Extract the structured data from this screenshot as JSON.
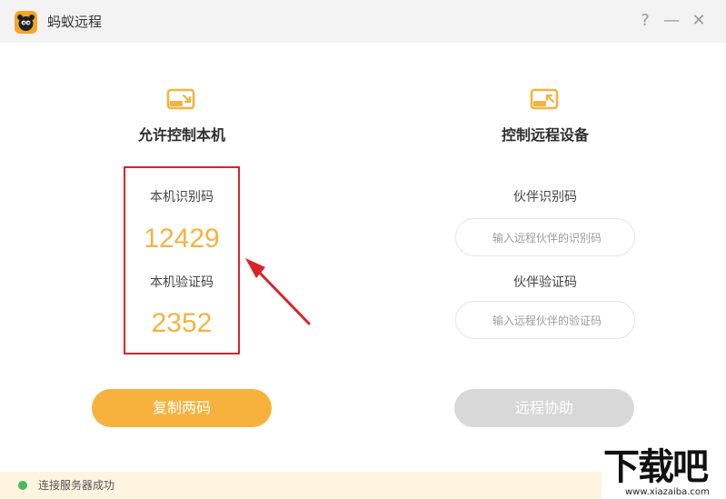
{
  "window": {
    "title": "蚂蚁远程",
    "help": "?",
    "minimize": "—",
    "close": "✕"
  },
  "left_panel": {
    "heading": "允许控制本机",
    "id_label": "本机识别码",
    "id_value": "12429",
    "code_label": "本机验证码",
    "code_value": "2352",
    "copy_button": "复制两码"
  },
  "right_panel": {
    "heading": "控制远程设备",
    "partner_id_label": "伙伴识别码",
    "partner_id_placeholder": "输入远程伙伴的识别码",
    "partner_code_label": "伙伴验证码",
    "partner_code_placeholder": "输入远程伙伴的验证码",
    "assist_button": "远程协助"
  },
  "status": {
    "text": "连接服务器成功",
    "color": "#3fbf5a"
  },
  "watermark": {
    "text": "下载吧",
    "url": "www.xiazaiba.com"
  },
  "colors": {
    "accent": "#f6b23d",
    "highlight": "#d9232a",
    "disabled": "#d8d8d8"
  }
}
